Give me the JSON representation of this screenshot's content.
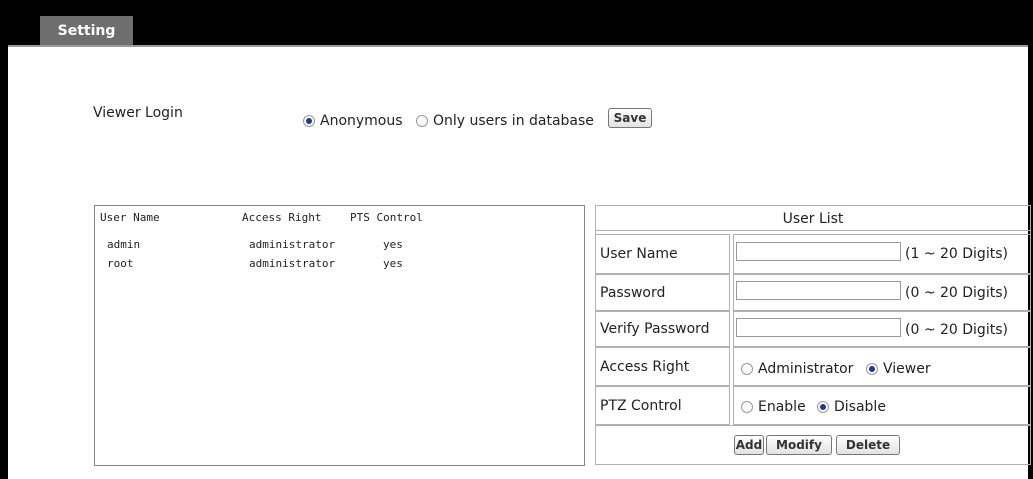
{
  "header": {
    "tab_label": "Setting"
  },
  "viewer_login": {
    "label": "Viewer Login",
    "option_anonymous": "Anonymous",
    "option_db_users": "Only users in database",
    "save_label": "Save"
  },
  "user_table": {
    "columns": [
      "User Name",
      "Access Right",
      "PTS Control"
    ],
    "rows": [
      {
        "name": "admin",
        "right": "administrator",
        "control": "yes"
      },
      {
        "name": "root",
        "right": "administrator",
        "control": "yes"
      }
    ]
  },
  "user_list": {
    "title": "User List",
    "username_label": "User Name",
    "username_hint": "(1 ~ 20 Digits)",
    "password_label": "Password",
    "password_hint": "(0 ~ 20 Digits)",
    "verify_label": "Verify Password",
    "verify_hint": "(0 ~ 20 Digits)",
    "access_label": "Access Right",
    "access_admin": "Administrator",
    "access_viewer": "Viewer",
    "ptz_label": "PTZ Control",
    "ptz_enable": "Enable",
    "ptz_disable": "Disable",
    "add_label": "Add",
    "modify_label": "Modify",
    "delete_label": "Delete"
  },
  "colors": {
    "topbar": "#000000",
    "tab": "#6e6e6e",
    "radio_dot": "#1a3d8f"
  }
}
